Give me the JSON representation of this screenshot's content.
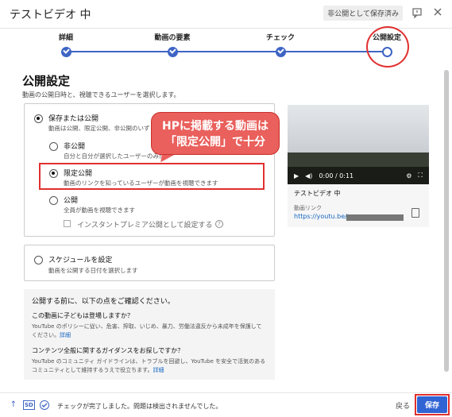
{
  "window": {
    "title": "テストビデオ 中",
    "draft_badge": "非公開として保存済み",
    "flag_icon": "feedback-icon",
    "close_icon": "close-icon"
  },
  "stepper": {
    "steps": [
      {
        "label": "詳細",
        "state": "done"
      },
      {
        "label": "動画の要素",
        "state": "done"
      },
      {
        "label": "チェック",
        "state": "done"
      },
      {
        "label": "公開設定",
        "state": "current"
      }
    ],
    "accent": "#3e65c4"
  },
  "page": {
    "title": "公開設定",
    "subtitle": "動画の公開日時と、視聴できるユーザーを選択します。"
  },
  "visibility": {
    "save_or_publish": {
      "label": "保存または公開",
      "desc": "動画は公開、限定公開、非公開のいず"
    },
    "options": [
      {
        "label": "非公開",
        "desc": "自分と自分が選択したユーザーのみが",
        "selected": false
      },
      {
        "label": "限定公開",
        "desc": "動画のリンクを知っているユーザーが動画を視聴できます",
        "selected": true
      },
      {
        "label": "公開",
        "desc": "全員が動画を視聴できます",
        "selected": false
      }
    ],
    "instant_premiere": "インスタントプレミア公開として設定する"
  },
  "schedule": {
    "label": "スケジュールを設定",
    "desc": "動画を公開する日付を選択します"
  },
  "callout": {
    "line1": "HPに掲載する動画は",
    "line2": "「限定公開」で十分"
  },
  "video": {
    "time": "0:00 / 0:11",
    "title": "テストビデオ 中",
    "link_label": "動画リンク",
    "link_url": "https://youtu.be/"
  },
  "notice": {
    "heading": "公開する前に、以下の点をご確認ください。",
    "q1": "この動画に子どもは登場しますか？",
    "t1": "YouTube のポリシーに従い、危害、搾取、いじめ、暴力、労働法違反から未成年を保護してください。",
    "t1_link": "詳細",
    "q2": "コンテンツ全般に関するガイダンスをお探しですか？",
    "t2": "YouTube のコミュニティ ガイドラインは、トラブルを回避し、YouTube を安全で活気のあるコミュニティとして維持するうえで役立ちます。",
    "t2_link": "詳細"
  },
  "footer": {
    "sd_badge": "SD",
    "message": "チェックが完了しました。問題は検出されませんでした。",
    "back_label": "戻る",
    "save_label": "保存"
  }
}
